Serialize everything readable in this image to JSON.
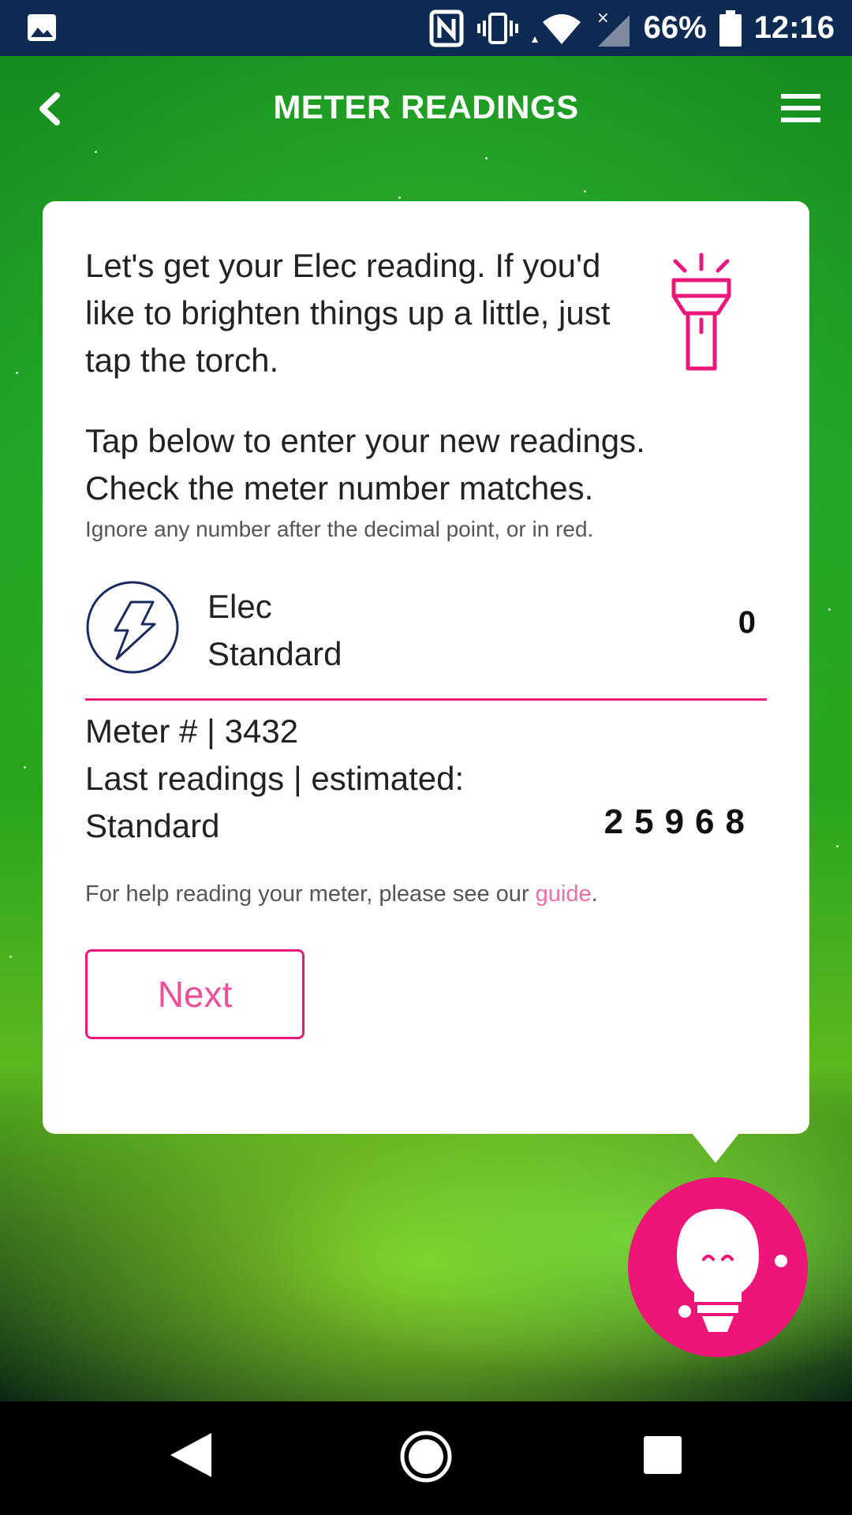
{
  "status_bar": {
    "battery": "66%",
    "time": "12:16"
  },
  "header": {
    "title": "METER READINGS"
  },
  "card": {
    "intro": "Let's get your Elec reading. If you'd like to brighten things up a little, just tap the torch.",
    "instruction_line1": "Tap below to enter your new readings.",
    "instruction_line2": "Check the meter number matches.",
    "note": "Ignore any number after the decimal point, or in red.",
    "register": {
      "fuel": "Elec",
      "rate": "Standard",
      "value": "0"
    },
    "meter_number": "Meter # | 3432",
    "last_readings_label": "Last readings | estimated:",
    "last_rate": "Standard",
    "last_value": "25968",
    "help_prefix": "For help reading your meter, please see our ",
    "help_link": "guide",
    "help_suffix": ".",
    "next_label": "Next"
  },
  "colors": {
    "accent": "#e8197a",
    "status_bar": "#0d2a52",
    "navy_icon": "#1b2a5e"
  }
}
